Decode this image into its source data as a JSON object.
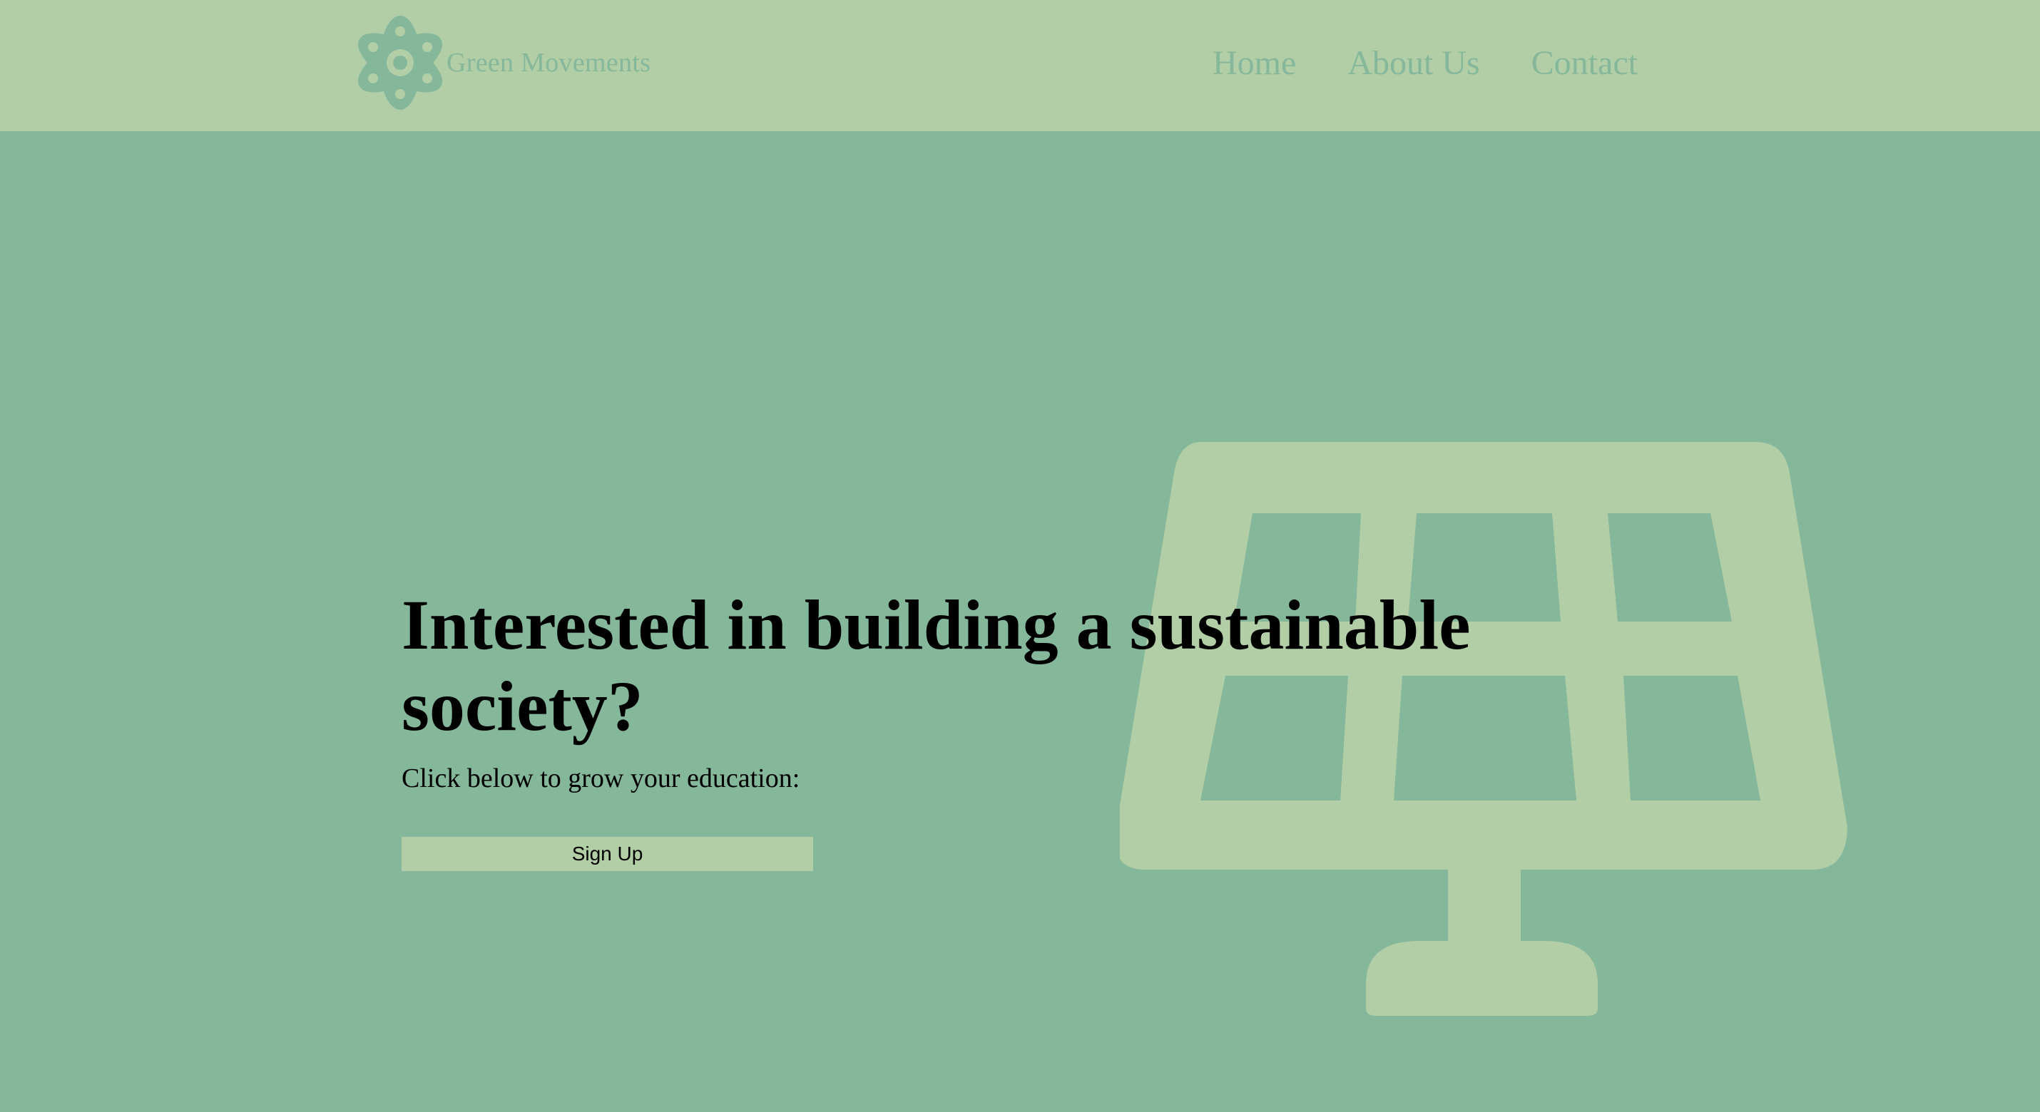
{
  "brand": {
    "name": "Green Movements",
    "icon": "atom-flower-icon"
  },
  "nav": {
    "items": [
      {
        "label": "Home"
      },
      {
        "label": "About Us"
      },
      {
        "label": "Contact"
      }
    ]
  },
  "hero": {
    "title": "Interested in building a sustainable society?",
    "subtitle": "Click below to grow your education:",
    "button_label": "Sign Up",
    "illustration": "solar-panel-icon"
  },
  "colors": {
    "header_background": "#b2cea6",
    "page_background": "#85b79b",
    "accent_text": "#85b79b",
    "button_background": "#b2cea6",
    "heading_text": "#000000"
  }
}
